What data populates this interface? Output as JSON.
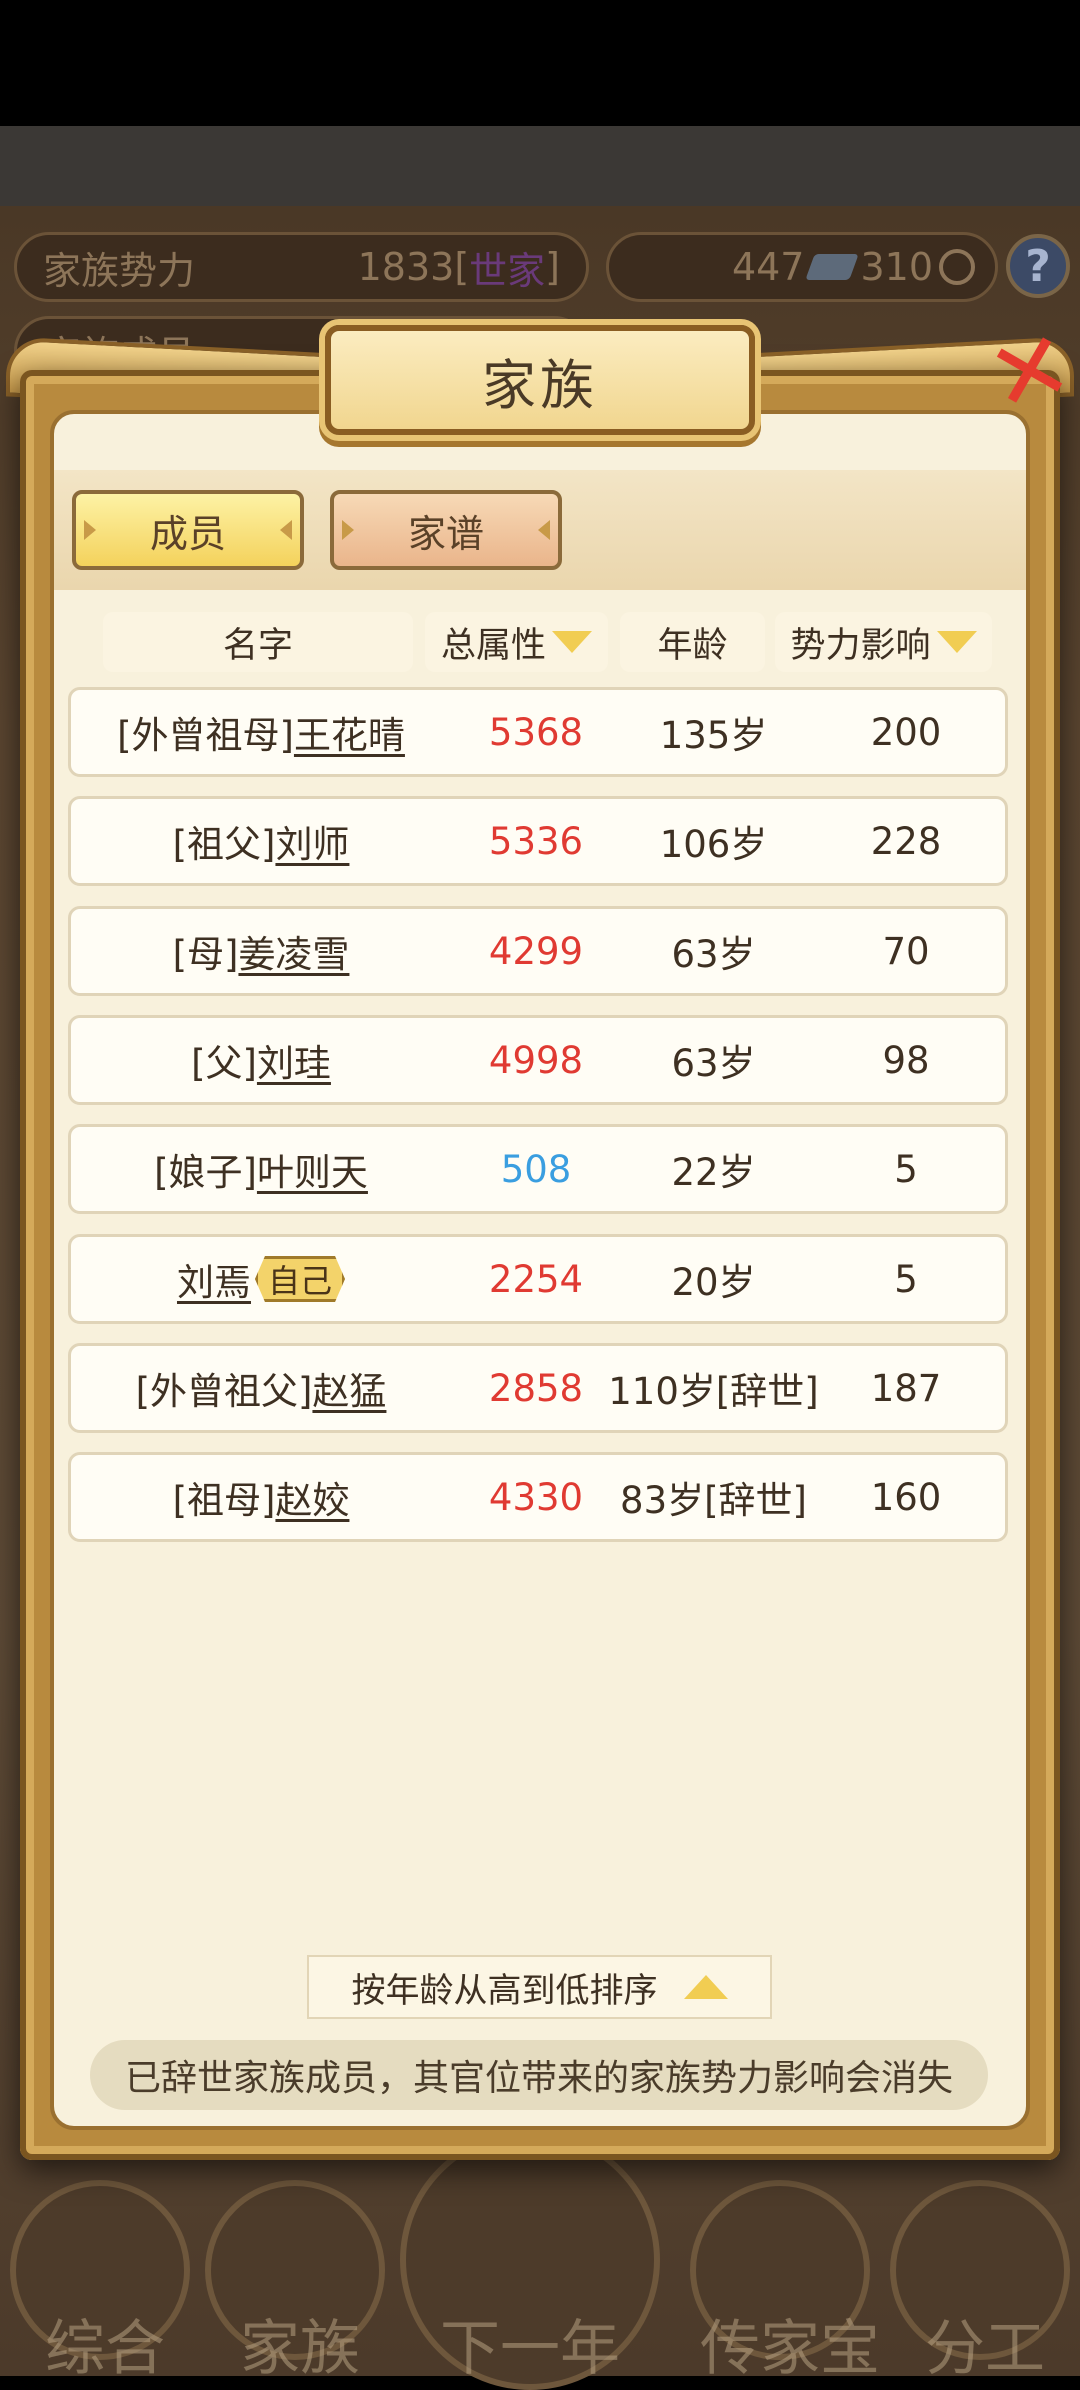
{
  "background": {
    "power_label": "家族势力",
    "power_value": "1833",
    "power_rank": "[",
    "power_rank_tag": "世家",
    "power_rank_end": "]",
    "currency_a": "447",
    "currency_b": "310",
    "members_label": "家族成员",
    "help_icon": "?",
    "nav": [
      "综合",
      "家族",
      "下一年",
      "传家宝",
      "分工"
    ]
  },
  "dialog": {
    "title": "家族",
    "close_icon": "✕",
    "tabs": [
      {
        "label": "成员",
        "active": true
      },
      {
        "label": "家谱",
        "active": false
      }
    ],
    "columns": [
      "名字",
      "总属性",
      "年龄",
      "势力影响"
    ],
    "rows": [
      {
        "prefix": "[外曾祖母]",
        "name": "王花晴",
        "attr": "5368",
        "age": "135岁",
        "influence": "200",
        "attr_color": "#e03a32"
      },
      {
        "prefix": "[祖父]",
        "name": "刘师",
        "attr": "5336",
        "age": "106岁",
        "influence": "228",
        "attr_color": "#e03a32"
      },
      {
        "prefix": "[母]",
        "name": "姜凌雪",
        "attr": "4299",
        "age": "63岁",
        "influence": "70",
        "attr_color": "#e03a32"
      },
      {
        "prefix": "[父]",
        "name": "刘珪",
        "attr": "4998",
        "age": "63岁",
        "influence": "98",
        "attr_color": "#e03a32"
      },
      {
        "prefix": "[娘子]",
        "name": "叶则天",
        "attr": "508",
        "age": "22岁",
        "influence": "5",
        "attr_color": "#3a9ee0"
      },
      {
        "prefix": "",
        "name": "刘焉",
        "badge": "自己",
        "attr": "2254",
        "age": "20岁",
        "influence": "5",
        "attr_color": "#e03a32"
      },
      {
        "prefix": "[外曾祖父]",
        "name": "赵猛",
        "attr": "2858",
        "age": "110岁[辞世]",
        "influence": "187",
        "attr_color": "#e03a32"
      },
      {
        "prefix": "[祖母]",
        "name": "赵姣",
        "attr": "4330",
        "age": "83岁[辞世]",
        "influence": "160",
        "attr_color": "#e03a32"
      }
    ],
    "sort_label": "按年龄从高到低排序",
    "notice": "已辞世家族成员，其官位带来的家族势力影响会消失"
  }
}
